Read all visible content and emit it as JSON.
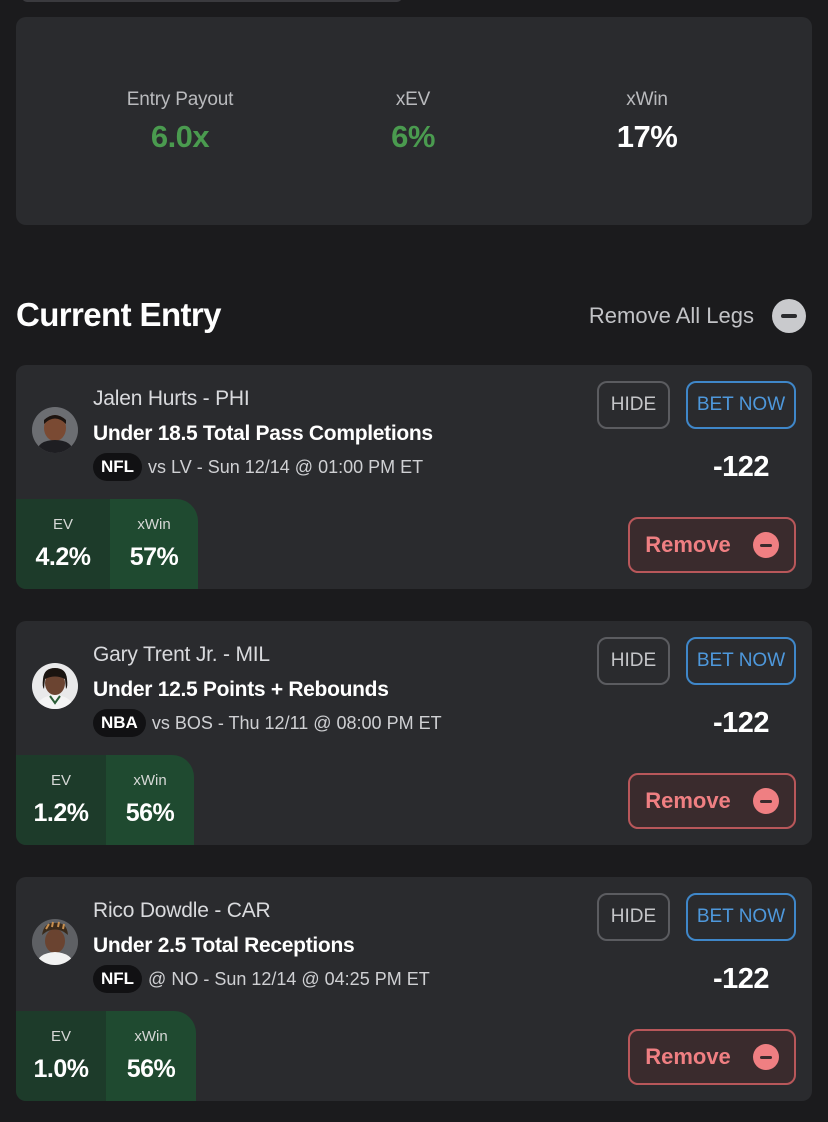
{
  "summary": {
    "entry_payout_label": "Entry Payout",
    "entry_payout_value": "6.0x",
    "xev_label": "xEV",
    "xev_value": "6%",
    "xwin_label": "xWin",
    "xwin_value": "17%"
  },
  "current_entry": {
    "title": "Current Entry",
    "remove_all_label": "Remove All Legs"
  },
  "legs": [
    {
      "player": "Jalen Hurts - PHI",
      "market": "Under 18.5 Total Pass Completions",
      "league": "NFL",
      "game": "vs LV - Sun 12/14 @ 01:00 PM ET",
      "odds": "-122",
      "ev_label": "EV",
      "ev": "4.2%",
      "xwin_label": "xWin",
      "xwin": "57%",
      "hide_label": "HIDE",
      "bet_label": "BET NOW",
      "remove_label": "Remove"
    },
    {
      "player": "Gary Trent Jr. - MIL",
      "market": "Under 12.5 Points + Rebounds",
      "league": "NBA",
      "game": "vs BOS - Thu 12/11 @ 08:00 PM ET",
      "odds": "-122",
      "ev_label": "EV",
      "ev": "1.2%",
      "xwin_label": "xWin",
      "xwin": "56%",
      "hide_label": "HIDE",
      "bet_label": "BET NOW",
      "remove_label": "Remove"
    },
    {
      "player": "Rico Dowdle - CAR",
      "market": "Under 2.5 Total Receptions",
      "league": "NFL",
      "game": "@ NO - Sun 12/14 @ 04:25 PM ET",
      "odds": "-122",
      "ev_label": "EV",
      "ev": "1.0%",
      "xwin_label": "xWin",
      "xwin": "56%",
      "hide_label": "HIDE",
      "bet_label": "BET NOW",
      "remove_label": "Remove"
    }
  ],
  "colors": {
    "positive_green": "#4a9b4f",
    "bet_blue": "#4e98dc",
    "remove_red": "#ef7f82",
    "ev_panel": "#1d3b2a"
  }
}
